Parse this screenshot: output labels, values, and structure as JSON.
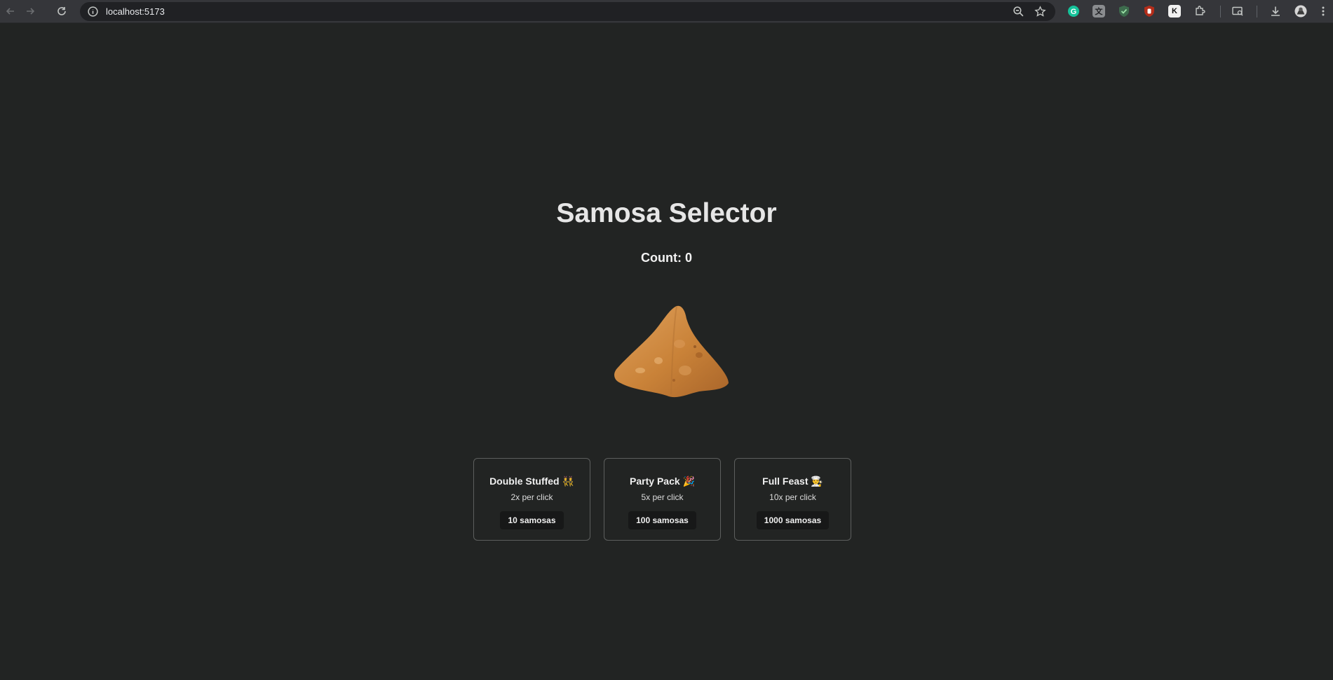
{
  "browser": {
    "url": "localhost:5173",
    "icons": [
      "back-icon",
      "forward-icon",
      "reload-icon",
      "info-icon",
      "zoom-icon",
      "star-icon",
      "extensions-icon",
      "downloads-icon",
      "profile-icon",
      "menu-icon"
    ],
    "extensions": [
      {
        "name": "grammarly-extension",
        "glyph": "G",
        "bg": "#15c39a",
        "fg": "#ffffff"
      },
      {
        "name": "translate-extension",
        "glyph": "文",
        "bg": "#8a8c8f",
        "fg": "#202124"
      },
      {
        "name": "shield-extension",
        "glyph": "✓",
        "bg": "#3d6b4d",
        "fg": "#9be0a6"
      },
      {
        "name": "ublock-extension",
        "glyph": "✋",
        "bg": "#b32d1a",
        "fg": "#ffffff"
      },
      {
        "name": "k-extension",
        "glyph": "K",
        "bg": "#f1f1f1",
        "fg": "#111111"
      }
    ]
  },
  "page": {
    "title": "Samosa Selector",
    "count": "Count: 0"
  },
  "upgrades": [
    {
      "name": "Double Stuffed 👯",
      "rate": "2x per click",
      "cost": "10 samosas"
    },
    {
      "name": "Party Pack 🎉",
      "rate": "5x per click",
      "cost": "100 samosas"
    },
    {
      "name": "Full Feast 👨‍🍳",
      "rate": "10x per click",
      "cost": "1000 samosas"
    }
  ],
  "colors": {
    "background": "#222423",
    "card_border": "#5d5f5e",
    "button_bg": "#171818",
    "samosa": "#d08a45"
  }
}
